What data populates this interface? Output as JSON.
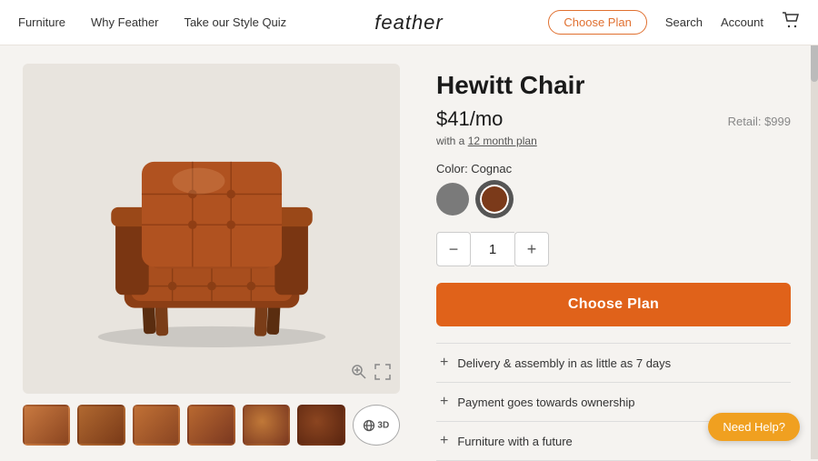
{
  "nav": {
    "links": [
      "Furniture",
      "Why Feather",
      "Take our Style Quiz"
    ],
    "brand": "feather",
    "right": {
      "choose_plan": "Choose Plan",
      "search": "Search",
      "account": "Account"
    }
  },
  "product": {
    "title": "Hewitt Chair",
    "price": "$41/mo",
    "retail": "Retail: $999",
    "plan_note": "with a ",
    "plan_link_text": "12 month plan",
    "color_label": "Color: Cognac",
    "colors": [
      {
        "name": "Gray",
        "class": "swatch-gray"
      },
      {
        "name": "Cognac",
        "class": "swatch-cognac",
        "selected": true
      }
    ],
    "quantity": 1,
    "cta_button": "Choose Plan",
    "accordions": [
      "Delivery & assembly in as little as 7 days",
      "Payment goes towards ownership",
      "Furniture with a future"
    ]
  },
  "help_button": "Need Help?",
  "thumbnails": [
    "1",
    "2",
    "3",
    "4",
    "5",
    "6"
  ],
  "view_3d": "3D"
}
